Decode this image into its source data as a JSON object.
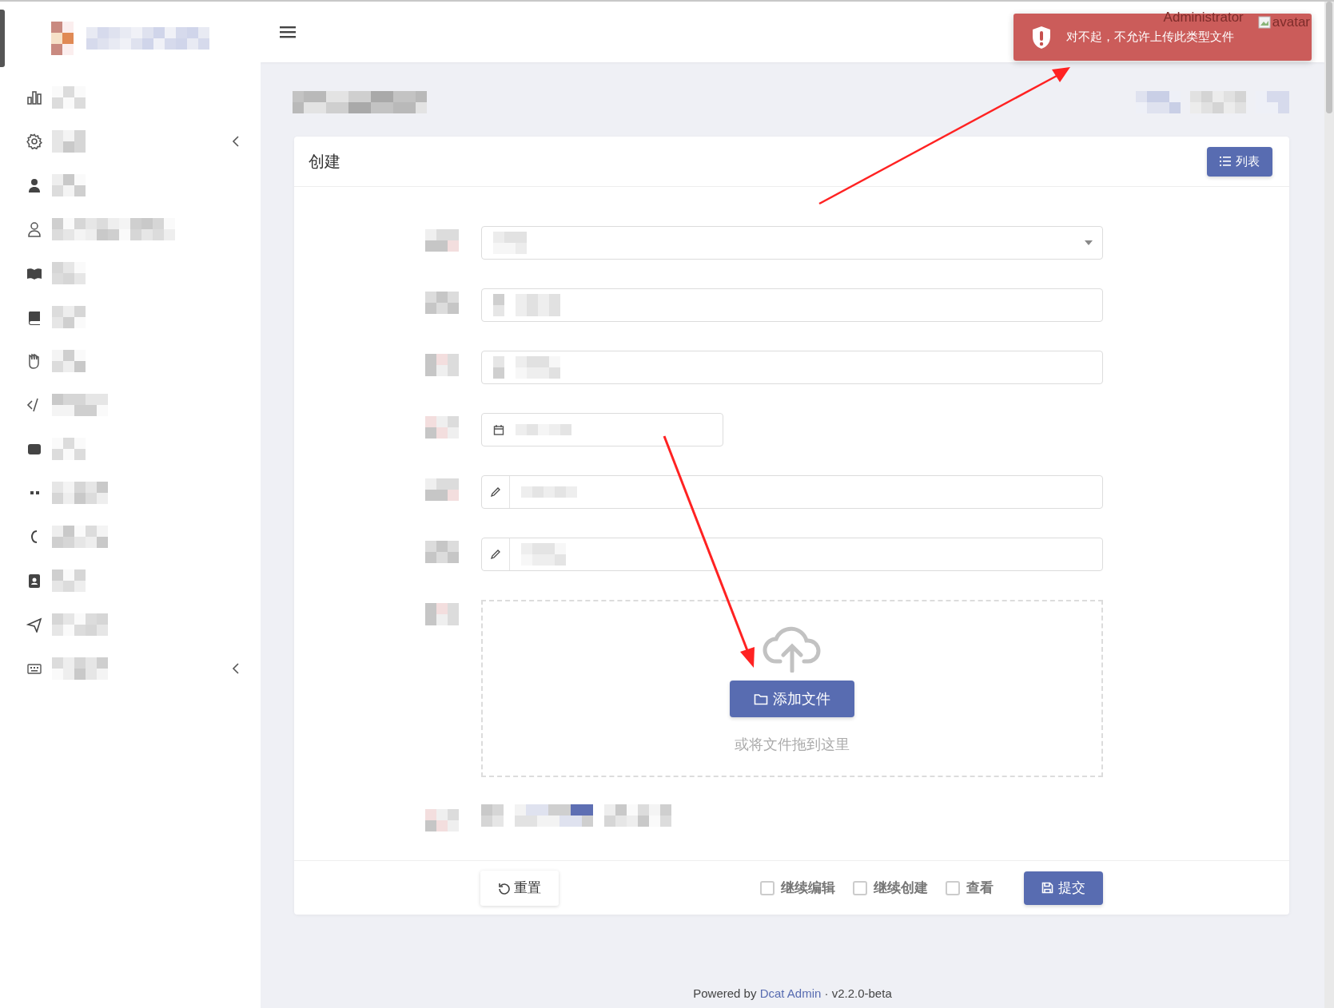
{
  "navbar": {
    "user_name": "Administrator",
    "avatar_alt": "avatar"
  },
  "toast": {
    "message": "对不起，不允许上传此类型文件"
  },
  "sidebar": {
    "items": [
      {
        "expandable": false
      },
      {
        "expandable": true
      },
      {
        "expandable": false
      },
      {
        "expandable": false
      },
      {
        "expandable": false
      },
      {
        "expandable": false
      },
      {
        "expandable": false
      },
      {
        "expandable": false
      },
      {
        "expandable": false
      },
      {
        "expandable": false
      },
      {
        "expandable": false
      },
      {
        "expandable": false
      },
      {
        "expandable": false
      },
      {
        "expandable": true
      }
    ]
  },
  "card": {
    "title": "创建",
    "list_button": "列表",
    "fields": [
      {
        "kind": "select"
      },
      {
        "kind": "text"
      },
      {
        "kind": "text"
      },
      {
        "kind": "date"
      },
      {
        "kind": "icon_text"
      },
      {
        "kind": "icon_text"
      },
      {
        "kind": "upload",
        "upload_button": "添加文件",
        "drop_hint": "或将文件拖到这里"
      },
      {
        "kind": "blurred"
      }
    ],
    "reset_button": "重置",
    "options": [
      {
        "label": "继续编辑",
        "checked": false
      },
      {
        "label": "继续创建",
        "checked": false
      },
      {
        "label": "查看",
        "checked": false
      }
    ],
    "submit_button": "提交"
  },
  "footer": {
    "prefix": "Powered by",
    "link": "Dcat Admin",
    "separator": "·",
    "version": "v2.2.0-beta"
  }
}
